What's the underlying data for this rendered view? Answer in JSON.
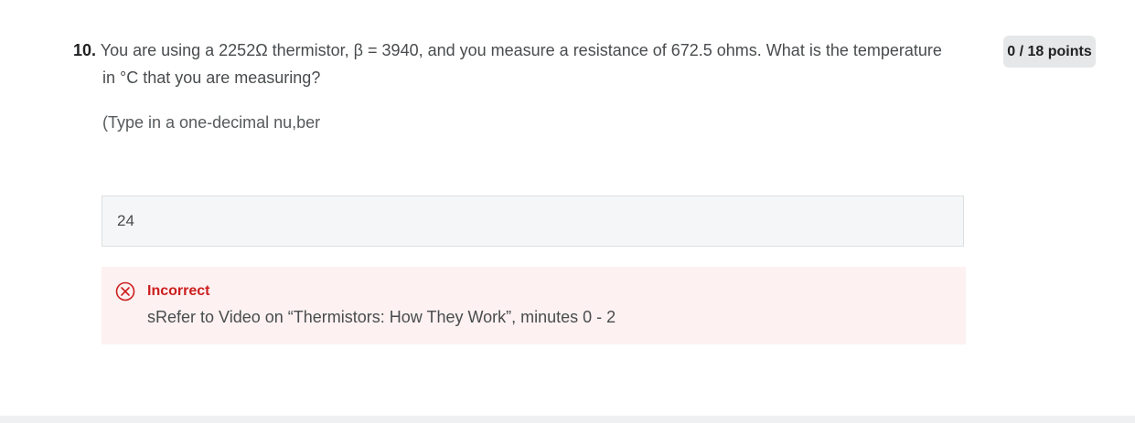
{
  "question": {
    "number": "10.",
    "text_line1": "You are using a 2252Ω thermistor, β = 3940, and you measure a resistance of 672.5 ohms. What is the temperature",
    "text_line2": "in °C that you are measuring?",
    "instruction": "(Type in a one-decimal nu,ber"
  },
  "points": {
    "label": "0 / 18 points"
  },
  "answer": {
    "value": "24"
  },
  "feedback": {
    "status": "Incorrect",
    "message": "sRefer to Video on “Thermistors: How They Work”, minutes 0 - 2",
    "icon": "x-circle-icon",
    "color": "#cd1e1e"
  }
}
